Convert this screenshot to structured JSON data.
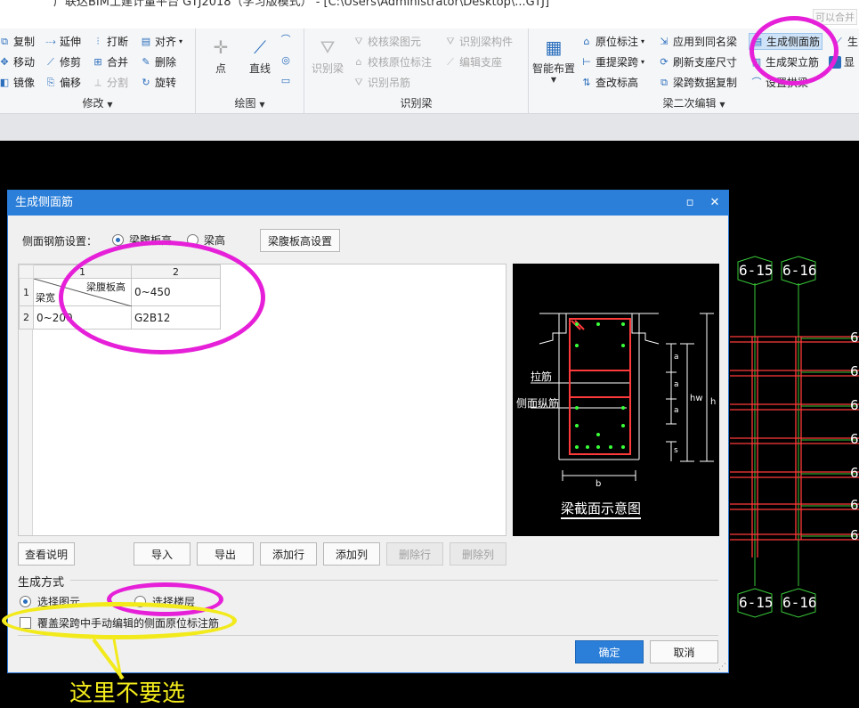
{
  "window": {
    "title": "广联达BIM土建计量平台 GTJ2018（学习版模式） - [C:\\Users\\Administrator\\Desktop\\...GTJ]",
    "corner_hint": "可以合并"
  },
  "ribbon": {
    "modify": {
      "label": "修改",
      "items": [
        "复制",
        "延伸",
        "打断",
        "对齐",
        "移动",
        "修剪",
        "合并",
        "删除",
        "镜像",
        "偏移",
        "分割",
        "旋转"
      ]
    },
    "draw": {
      "label": "绘图",
      "point": "点",
      "line": "直线"
    },
    "recognize": {
      "label": "识别梁",
      "big": "识别梁",
      "items": [
        "校核梁图元",
        "识别梁构件",
        "校核原位标注",
        "编辑支座",
        "识别吊筋"
      ]
    },
    "secondary": {
      "label": "梁二次编辑",
      "big": "智能布置",
      "items": [
        "原位标注",
        "应用到同名梁",
        "生成侧面筋",
        "重提梁跨",
        "刷新支座尺寸",
        "生成架立筋",
        "查改标高",
        "梁跨数据复制",
        "设置拱梁"
      ],
      "cut": [
        "生",
        "显"
      ]
    }
  },
  "canvas": {
    "axis_labels": [
      "6-15",
      "6-16",
      "6-15",
      "6-16"
    ],
    "right_marks": [
      "6",
      "6",
      "6",
      "6",
      "6",
      "6",
      "6"
    ]
  },
  "dialog": {
    "title": "生成侧面筋",
    "setting_label": "侧面钢筋设置：",
    "options": {
      "web_height": "梁腹板高",
      "beam_height": "梁高"
    },
    "selected_option": "web_height",
    "web_setting_button": "梁腹板高设置",
    "table": {
      "col_headers": [
        "1",
        "2"
      ],
      "row_headers": [
        "1",
        "2"
      ],
      "corner_top": "梁腹板高",
      "corner_bottom": "梁宽",
      "header_value": "0~450",
      "rows": [
        {
          "width": "0~200",
          "value": "G2B12"
        }
      ]
    },
    "preview": {
      "caption": "梁截面示意图",
      "label_tie": "拉筋",
      "label_side": "侧面纵筋",
      "dims": {
        "a1": "a",
        "a2": "a",
        "a3": "a",
        "s": "s",
        "hw": "hw",
        "h": "h",
        "b": "b"
      }
    },
    "buttons": {
      "help": "查看说明",
      "import": "导入",
      "export": "导出",
      "add_row": "添加行",
      "add_col": "添加列",
      "del_row": "删除行",
      "del_col": "删除列",
      "ok": "确定",
      "cancel": "取消"
    },
    "method": {
      "label": "生成方式",
      "pick_element": "选择图元",
      "pick_floor": "选择楼层",
      "selected": "pick_element"
    },
    "overwrite_label": "覆盖梁跨中手动编辑的侧面原位标注筋",
    "overwrite_checked": false
  },
  "annotation": {
    "text": "这里不要选",
    "color_magenta": "#e620d8",
    "color_yellow": "#f2ea1b"
  },
  "colors": {
    "accent": "#2b7fd9",
    "cad_red": "#ff3a3a",
    "cad_green": "#39c939"
  }
}
